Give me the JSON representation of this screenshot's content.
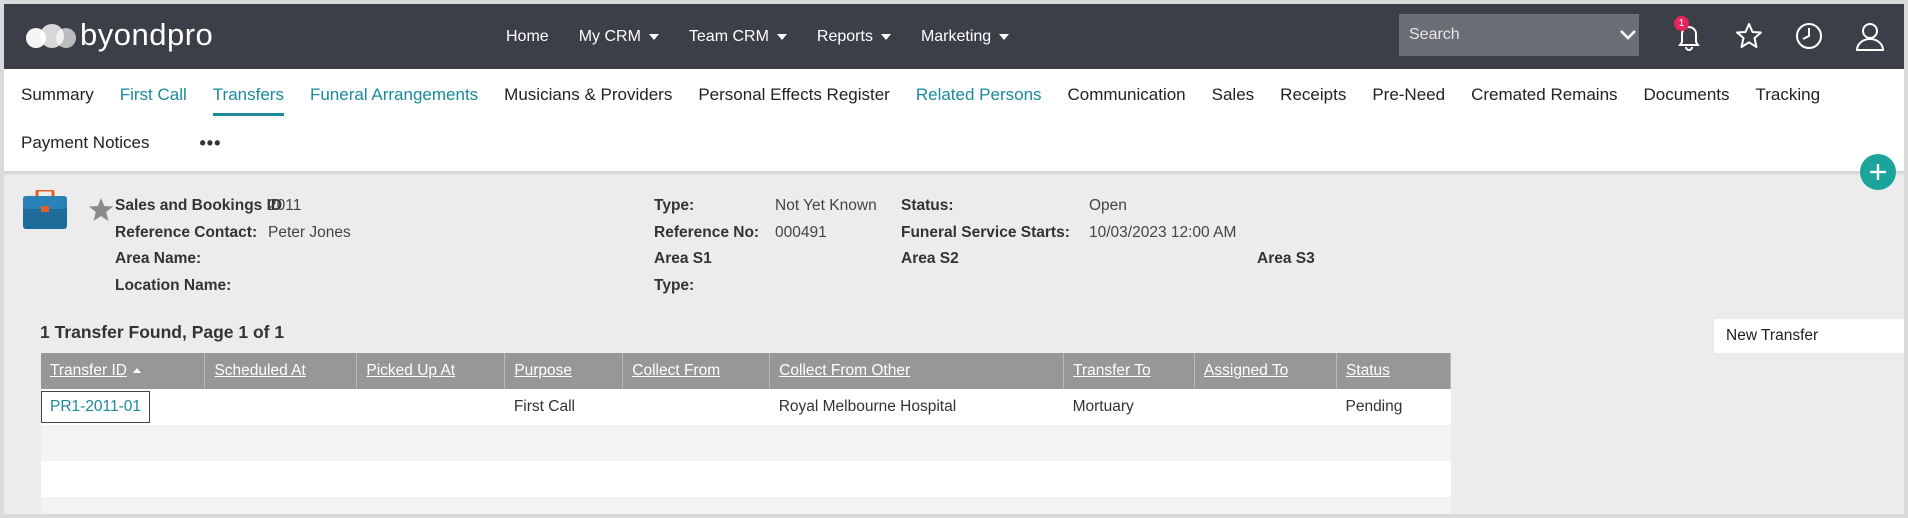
{
  "app": {
    "logo_text": "byondpro"
  },
  "nav": {
    "items": [
      {
        "label": "Home",
        "dropdown": false
      },
      {
        "label": "My CRM",
        "dropdown": true
      },
      {
        "label": "Team CRM",
        "dropdown": true
      },
      {
        "label": "Reports",
        "dropdown": true
      },
      {
        "label": "Marketing",
        "dropdown": true
      }
    ]
  },
  "search": {
    "placeholder": "Search"
  },
  "notifications": {
    "count": "1"
  },
  "tabs": {
    "row1": [
      {
        "label": "Summary",
        "style": "plain"
      },
      {
        "label": "First Call",
        "style": "link"
      },
      {
        "label": "Transfers",
        "style": "active"
      },
      {
        "label": "Funeral Arrangements",
        "style": "link"
      },
      {
        "label": "Musicians & Providers",
        "style": "plain"
      },
      {
        "label": "Personal Effects Register",
        "style": "plain"
      },
      {
        "label": "Related Persons",
        "style": "link"
      },
      {
        "label": "Communication",
        "style": "plain"
      },
      {
        "label": "Sales",
        "style": "plain"
      },
      {
        "label": "Receipts",
        "style": "plain"
      },
      {
        "label": "Pre-Need",
        "style": "plain"
      },
      {
        "label": "Cremated Remains",
        "style": "plain"
      },
      {
        "label": "Documents",
        "style": "plain"
      },
      {
        "label": "Tracking",
        "style": "plain"
      }
    ],
    "row2": [
      {
        "label": "Payment Notices",
        "style": "plain"
      }
    ],
    "more": "•••"
  },
  "record": {
    "sales_id_label": "Sales and Bookings ID",
    "sales_id_value": "2011",
    "ref_contact_label": "Reference Contact:",
    "ref_contact_value": "Peter Jones",
    "area_name_label": "Area Name:",
    "location_name_label": "Location Name:",
    "type_label": "Type:",
    "type_value": "Not Yet Known",
    "ref_no_label": "Reference No:",
    "ref_no_value": "000491",
    "area_s1_label": "Area S1",
    "type2_label": "Type:",
    "status_label": "Status:",
    "status_value": "Open",
    "service_starts_label": "Funeral Service Starts:",
    "service_starts_value": "10/03/2023 12:00 AM",
    "area_s2_label": "Area S2",
    "area_s3_label": "Area S3"
  },
  "transfers": {
    "summary": "1 Transfer Found, Page 1 of 1",
    "new_button": "New Transfer",
    "columns": [
      "Transfer ID",
      "Scheduled At",
      "Picked Up At",
      "Purpose",
      "Collect From",
      "Collect From Other",
      "Transfer To",
      "Assigned To",
      "Status"
    ],
    "rows": [
      [
        "PR1-2011-01",
        "",
        "",
        "First Call",
        "",
        "Royal Melbourne Hospital",
        "Mortuary",
        "",
        "Pending"
      ]
    ]
  }
}
